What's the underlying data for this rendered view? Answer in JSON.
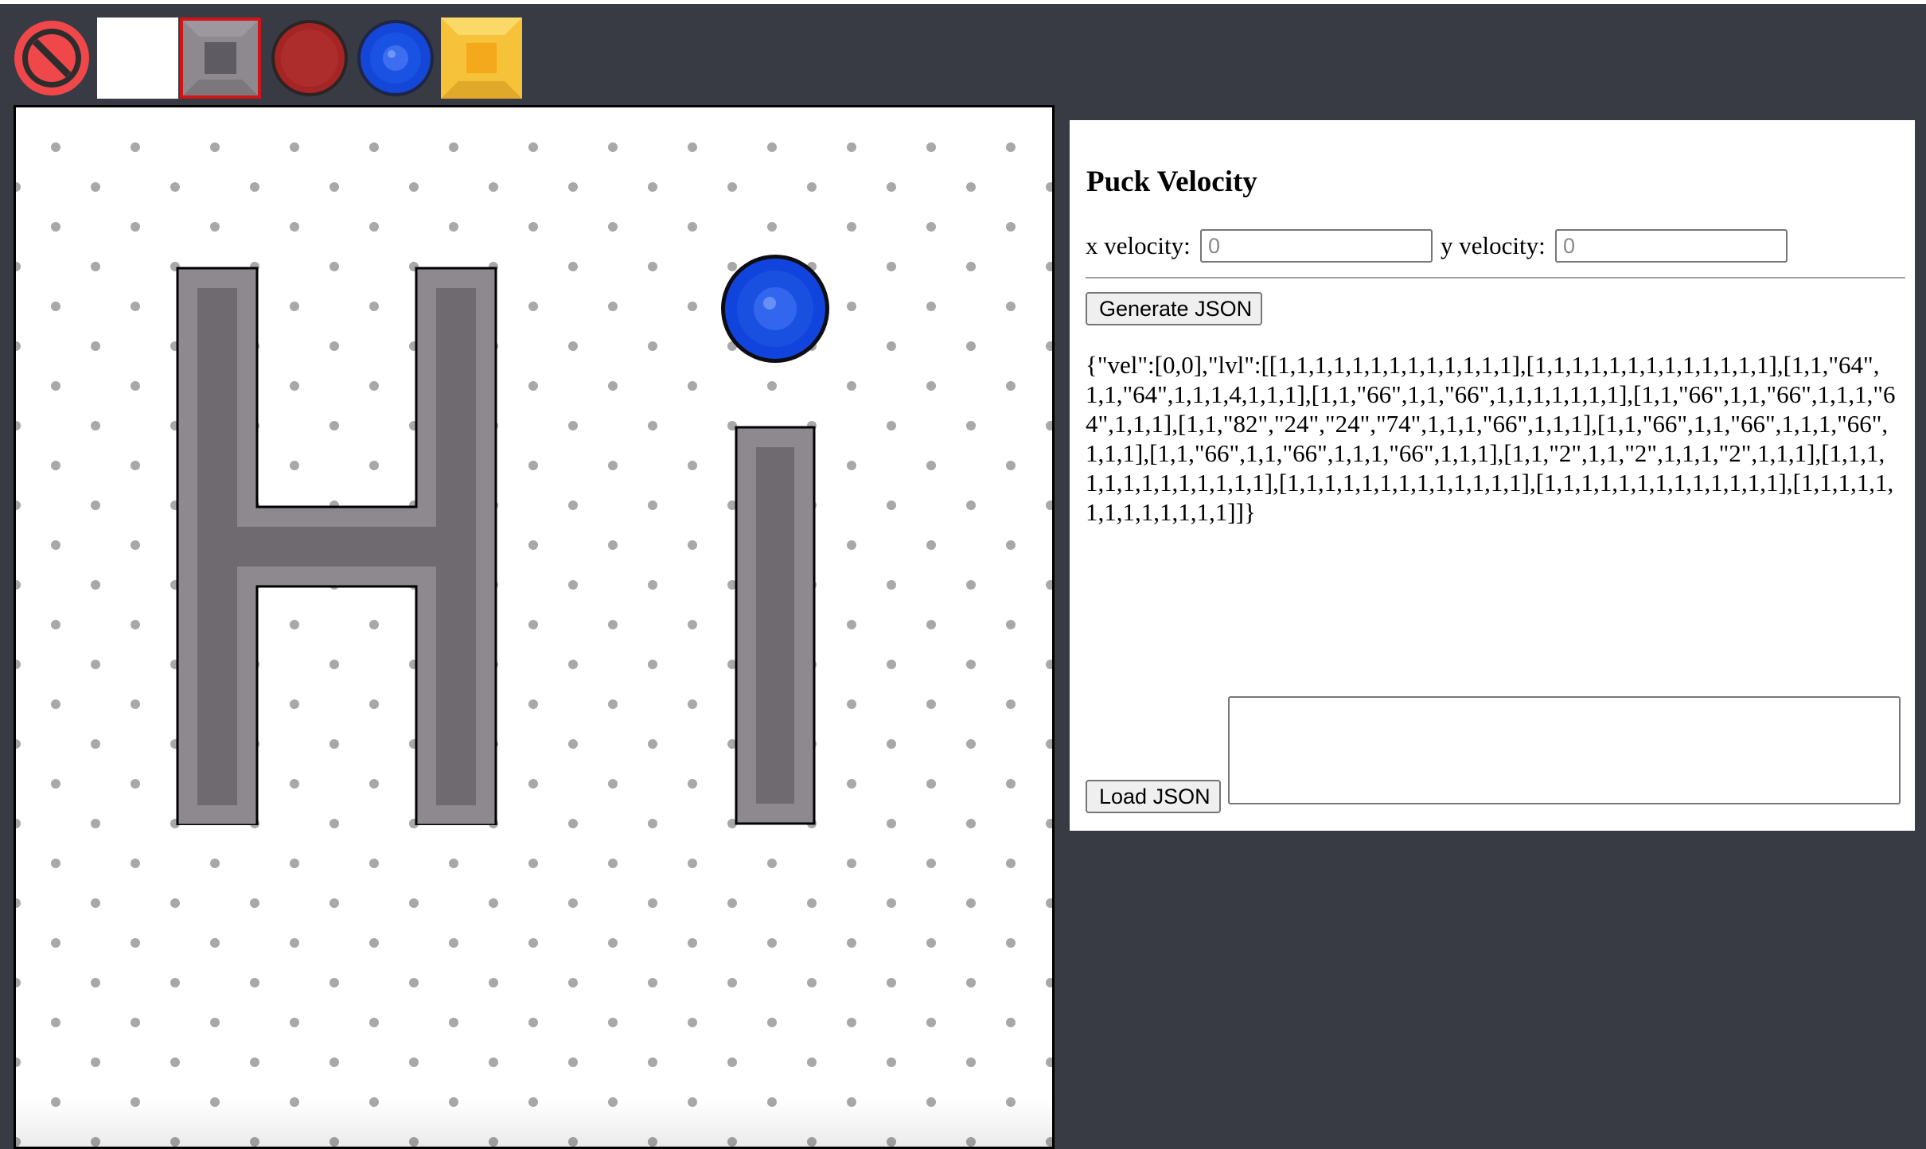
{
  "palette": {
    "tiles": [
      {
        "name": "eraser",
        "icon": "no-entry-icon",
        "selected": false
      },
      {
        "name": "empty",
        "icon": "empty-tile",
        "selected": false
      },
      {
        "name": "wall",
        "icon": "wall-block-icon",
        "selected": true
      },
      {
        "name": "red-puck",
        "icon": "red-puck-icon",
        "selected": false
      },
      {
        "name": "blue-puck",
        "icon": "blue-puck-icon",
        "selected": false
      },
      {
        "name": "goal",
        "icon": "goal-block-icon",
        "selected": false
      }
    ],
    "selected_color": "#d0151a"
  },
  "board": {
    "background": "#ffffff",
    "dot_color": "#a8a8a8",
    "wall_fill": "#6e6a70",
    "wall_bevel": "#8d898f",
    "puck_color": "#1144dd"
  },
  "panel": {
    "heading": "Puck Velocity",
    "x_velocity_label": "x velocity:",
    "x_velocity_placeholder": "0",
    "x_velocity_value": "",
    "y_velocity_label": "y velocity:",
    "y_velocity_placeholder": "0",
    "y_velocity_value": "",
    "generate_button": "Generate JSON",
    "json_output": "{\"vel\":[0,0],\"lvl\":[[1,1,1,1,1,1,1,1,1,1,1,1,1],[1,1,1,1,1,1,1,1,1,1,1,1,1],[1,1,\"64\",1,1,\"64\",1,1,1,4,1,1,1],[1,1,\"66\",1,1,\"66\",1,1,1,1,1,1,1],[1,1,\"66\",1,1,\"66\",1,1,1,\"64\",1,1,1],[1,1,\"82\",\"24\",\"24\",\"74\",1,1,1,\"66\",1,1,1],[1,1,\"66\",1,1,\"66\",1,1,1,\"66\",1,1,1],[1,1,\"66\",1,1,\"66\",1,1,1,\"66\",1,1,1],[1,1,\"2\",1,1,\"2\",1,1,1,\"2\",1,1,1],[1,1,1,1,1,1,1,1,1,1,1,1,1],[1,1,1,1,1,1,1,1,1,1,1,1,1],[1,1,1,1,1,1,1,1,1,1,1,1,1],[1,1,1,1,1,1,1,1,1,1,1,1,1]]}",
    "load_button": "Load JSON",
    "load_textarea_value": ""
  }
}
